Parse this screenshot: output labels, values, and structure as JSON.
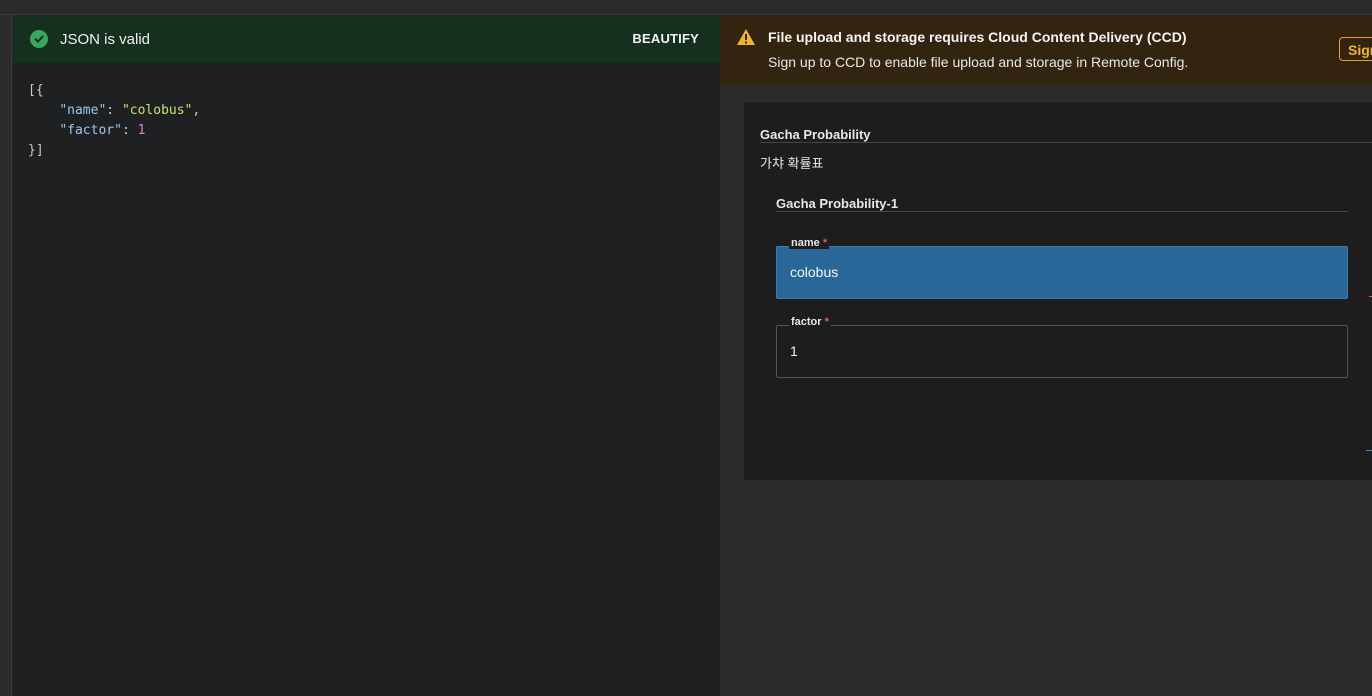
{
  "json_status": {
    "text": "JSON is valid",
    "beautify_label": "BEAUTIFY"
  },
  "code": {
    "open": "[{",
    "key_name": "\"name\"",
    "value_name": "\"colobus\"",
    "key_factor": "\"factor\"",
    "value_factor": "1",
    "close": "}]"
  },
  "warning": {
    "title": "File upload and storage requires Cloud Content Delivery (CCD)",
    "body": "Sign up to CCD to enable file upload and storage in Remote Config.",
    "button_label": "Sign up"
  },
  "form": {
    "section_title": "Gacha Probability",
    "section_description": "가챠 확률표",
    "item_title": "Gacha Probability-1",
    "fields": {
      "name": {
        "label": "name",
        "required_mark": "*",
        "value": "colobus"
      },
      "factor": {
        "label": "factor",
        "required_mark": "*",
        "value": "1"
      }
    }
  },
  "colors": {
    "valid_bg": "#16301f",
    "valid_icon": "#3aa65c",
    "warning_bg": "#33240f",
    "warning_accent": "#f0b429",
    "selected_field_bg": "#2a6799"
  },
  "icons": {
    "valid": "check-circle-icon",
    "warning": "warning-triangle-icon"
  }
}
